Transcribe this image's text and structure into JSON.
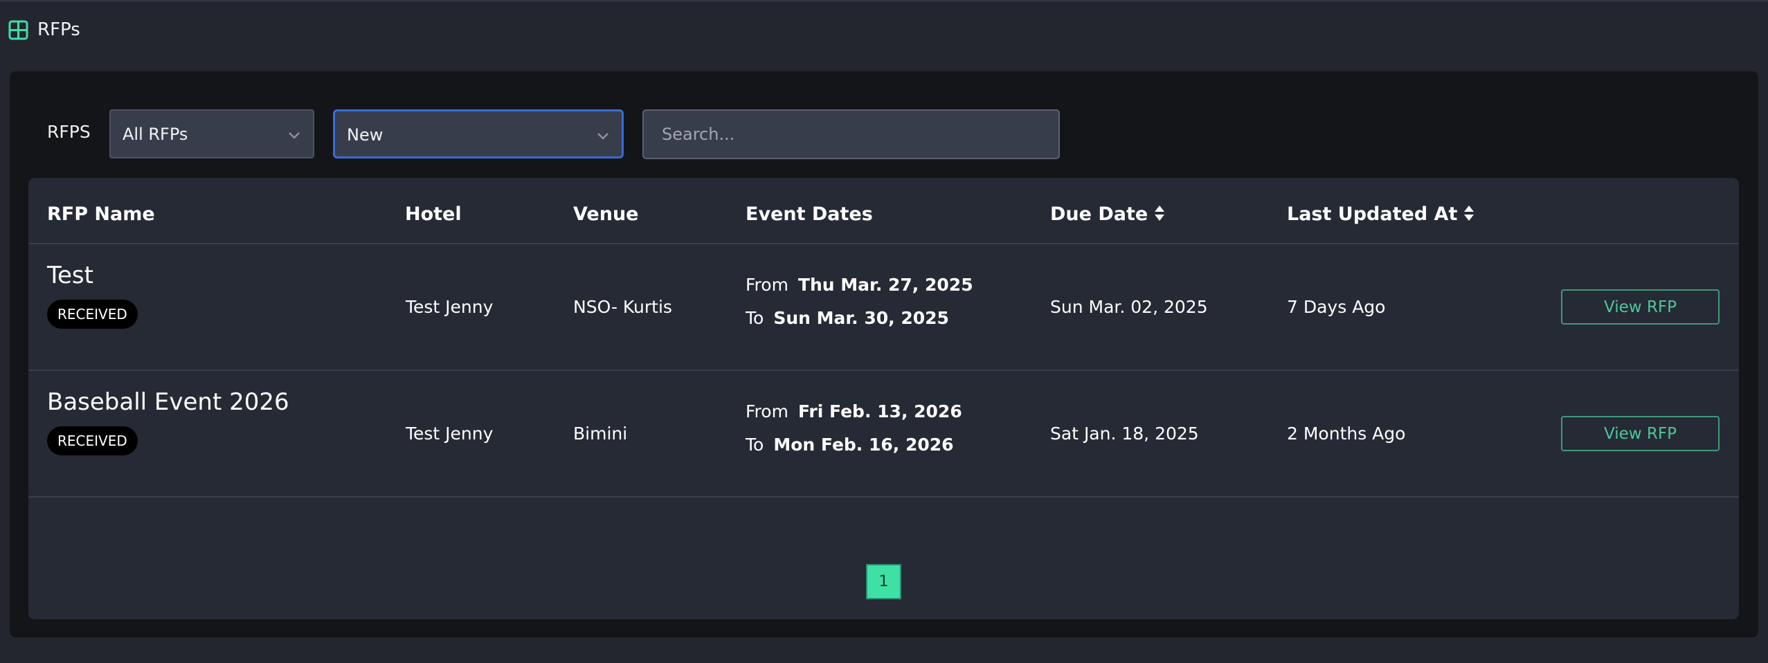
{
  "header": {
    "title": "RFPs",
    "icon": "table-icon"
  },
  "filters": {
    "label": "RFPS",
    "rfp_select": "All RFPs",
    "status_select": "New",
    "search_placeholder": "Search..."
  },
  "table": {
    "columns": {
      "rfp_name": "RFP Name",
      "hotel": "Hotel",
      "venue": "Venue",
      "event_dates": "Event Dates",
      "due_date": "Due Date",
      "last_updated": "Last Updated At"
    },
    "rows": [
      {
        "name": "Test",
        "status": "RECEIVED",
        "hotel": "Test Jenny",
        "venue": "NSO- Kurtis",
        "from_label": "From",
        "from": "Thu Mar. 27, 2025",
        "to_label": "To",
        "to": "Sun Mar. 30, 2025",
        "due_date": "Sun Mar. 02, 2025",
        "last_updated": "7 Days Ago",
        "action": "View RFP"
      },
      {
        "name": "Baseball Event 2026",
        "status": "RECEIVED",
        "hotel": "Test Jenny",
        "venue": "Bimini",
        "from_label": "From",
        "from": "Fri Feb. 13, 2026",
        "to_label": "To",
        "to": "Mon Feb. 16, 2026",
        "due_date": "Sat Jan. 18, 2025",
        "last_updated": "2 Months Ago",
        "action": "View RFP"
      }
    ]
  },
  "pagination": {
    "current_page": "1"
  },
  "colors": {
    "accent": "#3ee0a6",
    "button_text": "#4cc79c",
    "focus_border": "#3a6bd6",
    "background": "#23262f",
    "panel": "#141518"
  }
}
